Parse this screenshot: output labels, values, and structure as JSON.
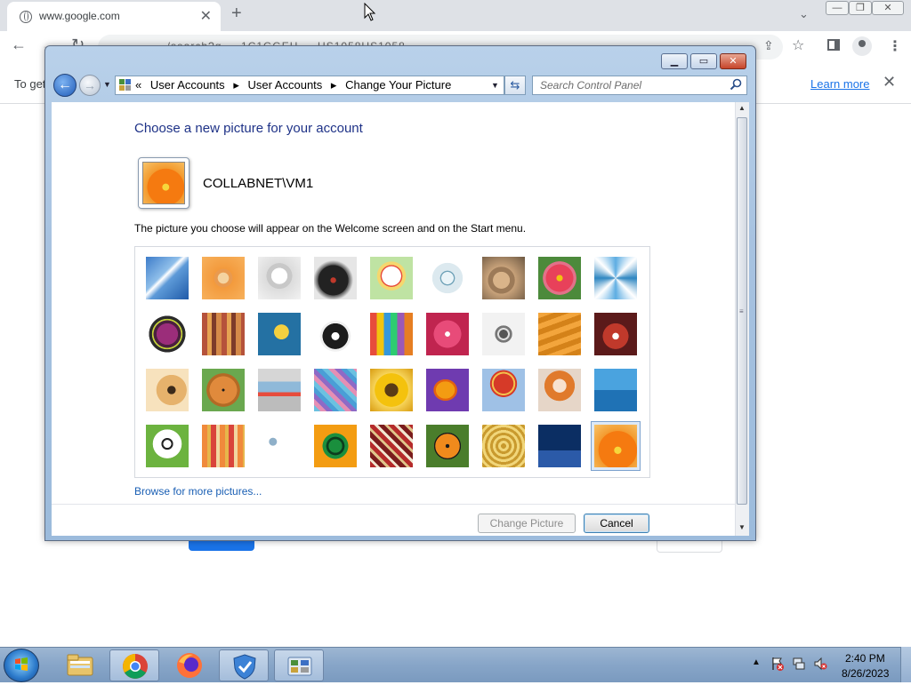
{
  "browser": {
    "tab_title": "www.google.com",
    "new_tab": "+",
    "tab_close": "✕",
    "url_text": "… … …/search?q … 1C1GGEH … US1058US1058 … …",
    "infobar_text": "To get",
    "learn_more": "Learn more"
  },
  "dialog": {
    "title": "",
    "breadcrumb": {
      "prefix": "«",
      "items": [
        "User Accounts",
        "User Accounts",
        "Change Your Picture"
      ]
    },
    "search_placeholder": "Search Control Panel",
    "heading": "Choose a new picture for your account",
    "account_name": "COLLABNET\\VM1",
    "description": "The picture you choose will appear on the Welcome screen and on the Start menu.",
    "browse_link": "Browse for more pictures...",
    "buttons": {
      "change": "Change Picture",
      "cancel": "Cancel"
    },
    "pictures": [
      {
        "name": "roller-coaster",
        "selected": false
      },
      {
        "name": "starfish",
        "selected": false
      },
      {
        "name": "robot-dog",
        "selected": false
      },
      {
        "name": "record-player",
        "selected": false
      },
      {
        "name": "lucky-cat",
        "selected": false
      },
      {
        "name": "gyroscope",
        "selected": false
      },
      {
        "name": "kitten",
        "selected": false
      },
      {
        "name": "flower",
        "selected": false
      },
      {
        "name": "pinwheel",
        "selected": false
      },
      {
        "name": "ball",
        "selected": false
      },
      {
        "name": "fabric",
        "selected": false
      },
      {
        "name": "leaf",
        "selected": false
      },
      {
        "name": "dog",
        "selected": false
      },
      {
        "name": "crayons",
        "selected": false
      },
      {
        "name": "paper-star",
        "selected": false
      },
      {
        "name": "jacks",
        "selected": false
      },
      {
        "name": "stairs",
        "selected": false
      },
      {
        "name": "paper-crane",
        "selected": false
      },
      {
        "name": "guitar",
        "selected": false
      },
      {
        "name": "pomeranian",
        "selected": false
      },
      {
        "name": "toy-robot",
        "selected": false
      },
      {
        "name": "scarves",
        "selected": false
      },
      {
        "name": "sunflower",
        "selected": false
      },
      {
        "name": "fish",
        "selected": false
      },
      {
        "name": "balloon",
        "selected": false
      },
      {
        "name": "doll",
        "selected": false
      },
      {
        "name": "sailboat",
        "selected": false
      },
      {
        "name": "soccer-ball",
        "selected": false
      },
      {
        "name": "striped-fabric",
        "selected": false
      },
      {
        "name": "marbles",
        "selected": false
      },
      {
        "name": "window-frame",
        "selected": false
      },
      {
        "name": "rug",
        "selected": false
      },
      {
        "name": "butterfly",
        "selected": false
      },
      {
        "name": "dome",
        "selected": false
      },
      {
        "name": "lighthouse",
        "selected": false
      },
      {
        "name": "orange-flower",
        "selected": true
      }
    ]
  },
  "taskbar": {
    "time": "2:40 PM",
    "date": "8/26/2023",
    "apps": [
      "file-explorer",
      "chrome",
      "firefox",
      "security-shield",
      "control-panel"
    ]
  },
  "colors": {
    "accent": "#1e3287",
    "link": "#1a5fb4",
    "chrome_blue": "#1a73e8"
  }
}
